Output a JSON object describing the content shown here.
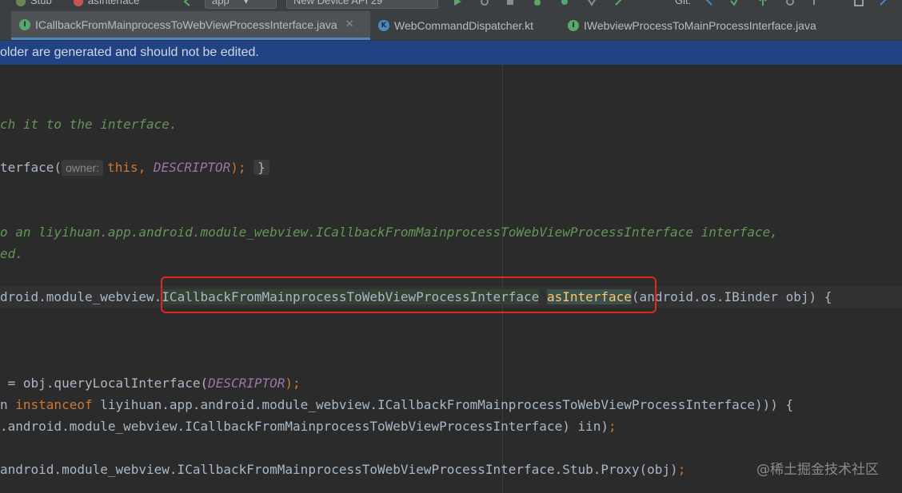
{
  "toolbar": {
    "stub_label": "Stub",
    "as_interface_label": "asInterface",
    "run_config": "app",
    "device": "New Device API 29",
    "git_label": "Git:"
  },
  "tabs": [
    {
      "label": "ICallbackFromMainprocessToWebViewProcessInterface.java",
      "icon": "interface-icon",
      "active": true,
      "closable": true
    },
    {
      "label": "WebCommandDispatcher.kt",
      "icon": "kotlin-icon",
      "active": false,
      "closable": false
    },
    {
      "label": "IWebviewProcessToMainProcessInterface.java",
      "icon": "interface-icon",
      "active": false,
      "closable": false
    }
  ],
  "banner": {
    "text": "older are generated and should not be edited."
  },
  "code": {
    "l1": "ch it to the interface.",
    "l2_a": "terface(",
    "l2_hint": "owner:",
    "l2_this": "this",
    "l2_sep": ", ",
    "l2_const": "DESCRIPTOR",
    "l2_end": ");",
    "l2_fold": "}",
    "l3": "o an liyihuan.app.android.module_webview.ICallbackFromMainprocessToWebViewProcessInterface interface,",
    "l4": "ed.",
    "l5_a": "droid.module_webview.",
    "l5_type": "ICallbackFromMainprocessToWebViewProcessInterface",
    "l5_method": "asInterface",
    "l5_b": "(android.os.IBinder obj) {",
    "l6_a": " = obj.queryLocalInterface(",
    "l6_const": "DESCRIPTOR",
    "l6_b": ");",
    "l7_a": "n ",
    "l7_kw": "instanceof",
    "l7_b": " liyihuan.app.android.module_webview.ICallbackFromMainprocessToWebViewProcessInterface))) {",
    "l8_a": ".android.module_webview.ICallbackFromMainprocessToWebViewProcessInterface) iin)",
    "l8_b": ";",
    "l9_a": "android.module_webview.ICallbackFromMainprocessToWebViewProcessInterface.Stub.Proxy(obj)",
    "l9_b": ";"
  },
  "watermark": "@稀土掘金技术社区",
  "colors": {
    "editor_bg": "#2b2b2b",
    "comment": "#629755",
    "keyword": "#cc7832",
    "constant": "#9876aa",
    "method": "#ffc66d",
    "banner_bg": "#214283",
    "highlight_box": "#e0281d",
    "active_tab_underline": "#4a88c7"
  }
}
